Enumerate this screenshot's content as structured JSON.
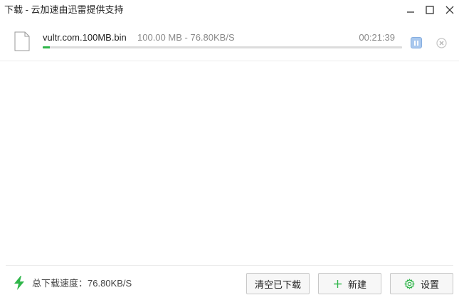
{
  "window": {
    "title": "下载 - 云加速由迅雷提供支持"
  },
  "downloads": [
    {
      "file_name": "vultr.com.100MB.bin",
      "size": "100.00 MB",
      "separator": "-",
      "speed": "76.80KB/S",
      "time_remaining": "00:21:39",
      "progress_fraction": 0.02
    }
  ],
  "footer": {
    "total_speed_label": "总下载速度：76.80KB/S",
    "clear_label": "清空已下载",
    "new_label": "新建",
    "settings_label": "设置"
  },
  "icons": {
    "file": "file-icon",
    "pause": "pause-icon",
    "remove": "close-circle-icon",
    "speed": "lightning-icon",
    "new": "plus-icon",
    "settings": "gear-icon"
  },
  "colors": {
    "progress": "#2fb64a",
    "pause_button": "#a9c8ee",
    "lightning": "#2fb64a",
    "gear": "#2fb64a",
    "plus": "#2fb64a"
  }
}
